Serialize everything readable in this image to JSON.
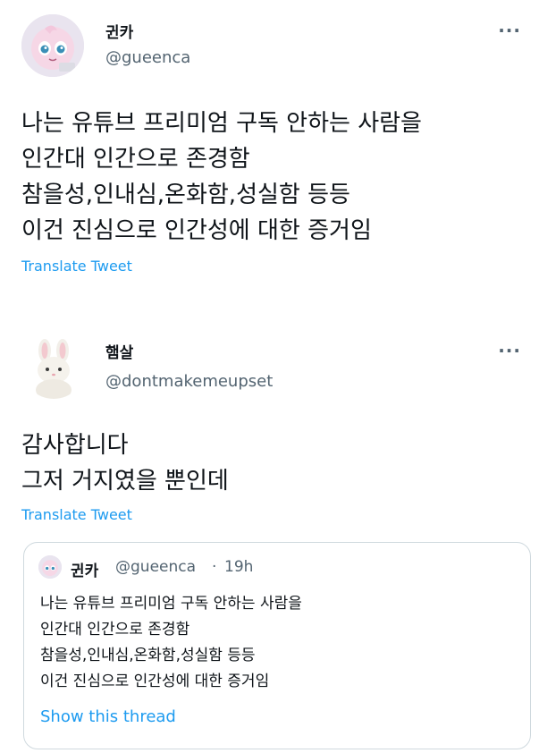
{
  "tweet1": {
    "display_name": "귄카",
    "handle": "@gueenca",
    "more_label": "···",
    "text": "나는 유튜브 프리미엄 구독 안하는 사람을\n인간대 인간으로 존경함\n참을성,인내심,온화함,성실함 등등\n이건 진심으로 인간성에 대한 증거임",
    "translate_label": "Translate Tweet",
    "avatar_icon": "jigglypuff-avatar-icon"
  },
  "tweet2": {
    "display_name": "햄살",
    "handle": "@dontmakemeupset",
    "more_label": "···",
    "text": "감사합니다\n그저 거지였을 뿐인데",
    "translate_label": "Translate Tweet",
    "avatar_icon": "white-rabbit-avatar-icon",
    "quote": {
      "display_name": "귄카",
      "handle": "@gueenca",
      "separator": "·",
      "time": "19h",
      "text": "나는 유튜브 프리미엄 구독 안하는 사람을\n인간대 인간으로 존경함\n참을성,인내심,온화함,성실함 등등\n이건 진심으로 인간성에 대한 증거임",
      "show_thread_label": "Show this thread"
    }
  },
  "colors": {
    "text_primary": "#0f1419",
    "text_secondary": "#536471",
    "link": "#1d9bf0",
    "border": "#cfd9de"
  }
}
